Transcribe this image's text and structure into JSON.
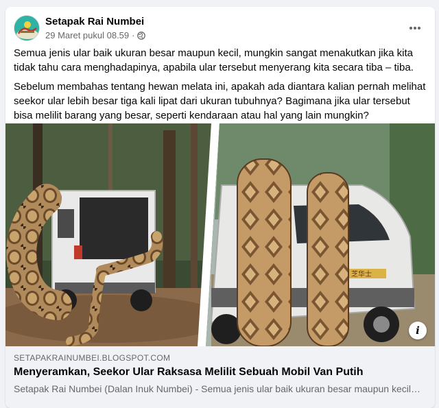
{
  "post": {
    "page_name": "Setapak Rai Numbei",
    "timestamp": "29 Maret pukul 08.59",
    "separator": "·",
    "privacy_icon": "globe-icon",
    "more_icon": "more-options-icon",
    "paragraphs": [
      "Semua jenis ular baik ukuran besar maupun kecil, mungkin sangat menakutkan jika kita tidak tahu cara menghadapinya, apabila ular tersebut menyerang kita secara tiba – tiba.",
      "Sebelum membahas tentang hewan melata ini, apakah ada diantara kalian pernah melihat seekor ular lebih besar tiga kali lipat dari ukuran tubuhnya? Bagimana jika ular tersebut bisa melilit barang yang besar, seperti kendaraan atau hal yang lain mungkin?"
    ]
  },
  "media": {
    "van_plate_text": "芝华士",
    "info_button_label": "i"
  },
  "link_preview": {
    "domain": "SETAPAKRAINUMBEI.BLOGSPOT.COM",
    "title": "Menyeramkan, Seekor Ular Raksasa Melilit Sebuah Mobil Van Putih",
    "description": "Setapak Rai Numbei (Dalan Inuk Numbei) - Semua jenis ular baik ukuran besar maupun kecil, mungkin sangat menakutkan jika kita tidak tahu cara menghadapinya"
  },
  "colors": {
    "background": "#f0f2f5",
    "card": "#ffffff",
    "secondary_text": "#65676b",
    "avatar_bg": "#2fb3a4"
  }
}
